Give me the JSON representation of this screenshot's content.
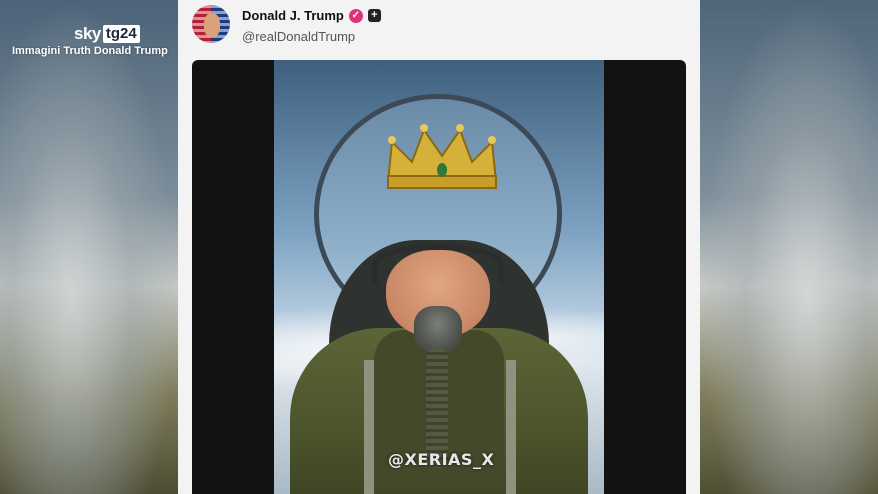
{
  "broadcaster": {
    "logo_sky": "sky",
    "logo_tg": "tg24",
    "caption": "Immagini Truth Donald Trump"
  },
  "post": {
    "author_name": "Donald J. Trump",
    "author_handle": "@realDonaldTrump",
    "verified_icon": "verified-badge-icon",
    "verified_color": "#e0317b",
    "plus_icon": "plus-icon",
    "media_watermark": "@XERIAS_X"
  },
  "colors": {
    "card_bg": "#f3f3f3",
    "media_bg": "#121212"
  }
}
